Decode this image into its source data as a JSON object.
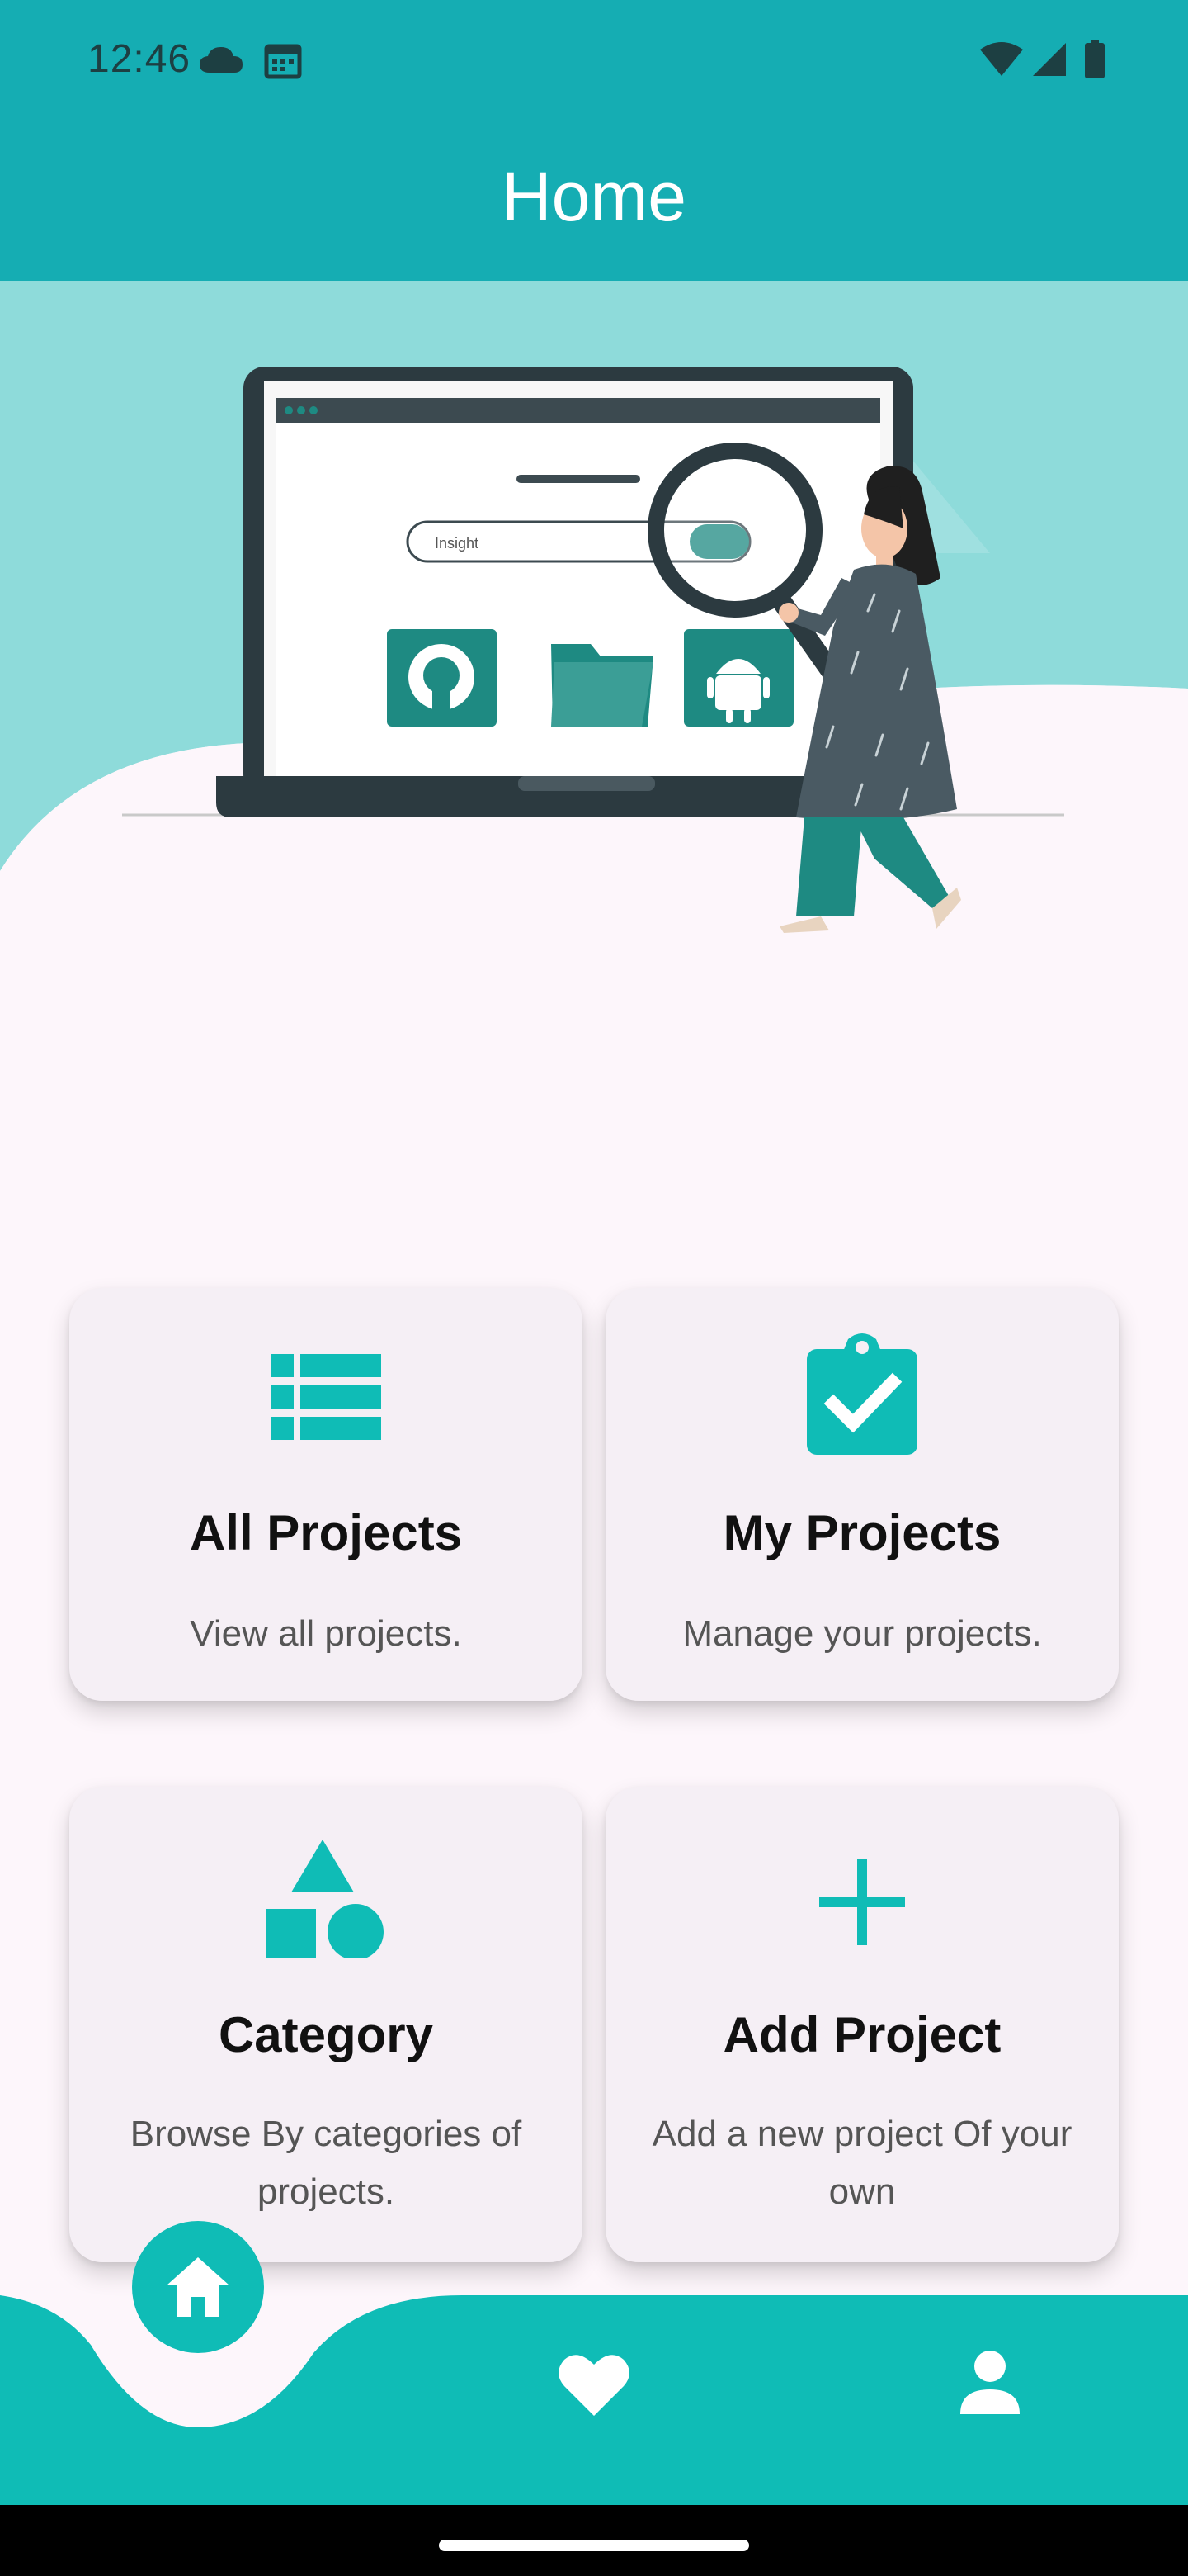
{
  "status_bar": {
    "time": "12:46",
    "icons_left": [
      "cloud-icon",
      "calendar-icon"
    ],
    "icons_right": [
      "wifi-icon",
      "signal-icon",
      "battery-icon"
    ]
  },
  "app_bar": {
    "title": "Home"
  },
  "hero": {
    "illustration": "woman-with-magnifier-laptop-illustration",
    "search_text": "Insight"
  },
  "cards": [
    {
      "title": "All Projects",
      "description": "View all projects.",
      "icon": "list-icon"
    },
    {
      "title": "My Projects",
      "description": "Manage your projects.",
      "icon": "clipboard-check-icon"
    },
    {
      "title": "Category",
      "description": "Browse By categories of projects.",
      "icon": "shapes-icon"
    },
    {
      "title": "Add Project",
      "description": "Add a new project Of your own",
      "icon": "plus-icon"
    }
  ],
  "bottom_nav": {
    "items": [
      {
        "name": "home",
        "icon": "home-icon",
        "active": true
      },
      {
        "name": "favorites",
        "icon": "heart-icon",
        "active": false
      },
      {
        "name": "profile",
        "icon": "person-icon",
        "active": false
      }
    ]
  },
  "colors": {
    "primary": "#15adb3",
    "accent": "#0fbcb6",
    "hero_bg": "#8edbda",
    "page_bg": "#fdf6fb",
    "card_bg": "#f5eff5"
  }
}
